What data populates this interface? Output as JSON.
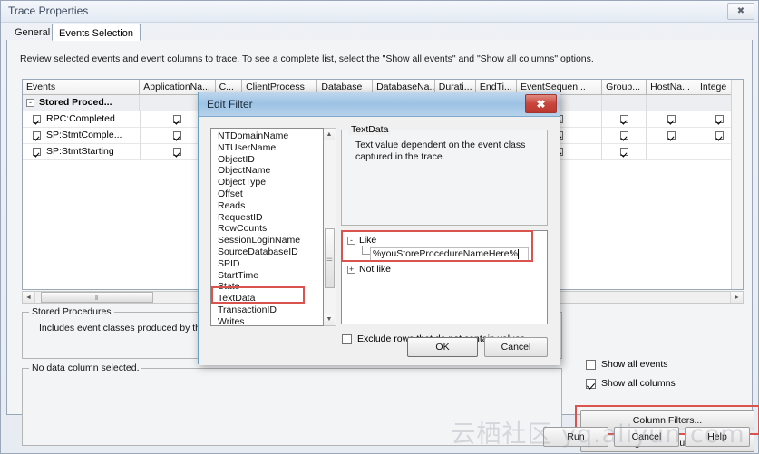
{
  "window": {
    "title": "Trace Properties",
    "close_glyph": "✖"
  },
  "tabs": {
    "general": "General",
    "events_selection": "Events Selection"
  },
  "intro_text": "Review selected events and event columns to trace. To see a complete list, select the \"Show all events\" and \"Show all columns\" options.",
  "grid": {
    "headers": [
      "Events",
      "ApplicationNa...",
      "C...",
      "ClientProcess",
      "Database",
      "DatabaseNa...",
      "Durati...",
      "EndTi...",
      "EventSequen...",
      "Group...",
      "HostNa...",
      "Intege"
    ],
    "group_row": {
      "expander": "-",
      "label": "Stored Proced..."
    },
    "rows": [
      {
        "event": "RPC:Completed",
        "checks": [
          true,
          true,
          true,
          true,
          true,
          true,
          true,
          true,
          true,
          true,
          true
        ]
      },
      {
        "event": "SP:StmtComple...",
        "checks": [
          true,
          true,
          true,
          true,
          true,
          true,
          true,
          true,
          true,
          true,
          true
        ]
      },
      {
        "event": "SP:StmtStarting",
        "checks": [
          true,
          true,
          true,
          true,
          true,
          true,
          true,
          true,
          true,
          false,
          false
        ]
      }
    ]
  },
  "stored_procedures_box": {
    "legend": "Stored Procedures",
    "text": "Includes event classes produced by th"
  },
  "no_data_box": {
    "legend": "No data column selected."
  },
  "options": {
    "show_all_events": {
      "label": "Show all events",
      "checked": false
    },
    "show_all_columns": {
      "label": "Show all columns",
      "checked": true
    }
  },
  "buttons": {
    "column_filters": "Column Filters...",
    "organize_columns": "Organize Columns...",
    "run": "Run",
    "cancel": "Cancel",
    "help": "Help"
  },
  "watermark": "云栖社区 yq.aliyun.com",
  "dialog": {
    "title": "Edit Filter",
    "close_glyph": "✖",
    "columns": [
      "NTDomainName",
      "NTUserName",
      "ObjectID",
      "ObjectName",
      "ObjectType",
      "Offset",
      "Reads",
      "RequestID",
      "RowCounts",
      "SessionLoginName",
      "SourceDatabaseID",
      "SPID",
      "StartTime",
      "State",
      "TextData",
      "TransactionID",
      "Writes"
    ],
    "selected_column": "TextData",
    "description": {
      "legend": "TextData",
      "text": "Text value dependent on the event class captured in the trace."
    },
    "filter_tree": {
      "like": {
        "expander": "-",
        "label": "Like",
        "value": "%youStoreProcedureNameHere%"
      },
      "not_like": {
        "expander": "+",
        "label": "Not like"
      }
    },
    "exclude_label": "Exclude rows that do not contain values",
    "ok": "OK",
    "cancel": "Cancel",
    "scroll_up_glyph": "▲",
    "scroll_down_glyph": "▼"
  },
  "scroll": {
    "left_glyph": "◄",
    "right_glyph": "►",
    "grip": "‖"
  },
  "colors": {
    "highlight_red": "#d9534f",
    "dialog_title": "#9cc2e4",
    "close_red": "#c9453c"
  }
}
